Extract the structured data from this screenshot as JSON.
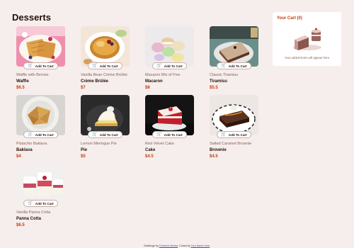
{
  "page": {
    "title": "Desserts"
  },
  "add_to_cart_label": "Add To Cart",
  "products": [
    {
      "category": "Waffle with Berries",
      "name": "Waffle",
      "price": "$6.5",
      "image": "waffle"
    },
    {
      "category": "Vanilla Bean Crème Brûlée",
      "name": "Crème Brûlée",
      "price": "$7",
      "image": "creme-brulee"
    },
    {
      "category": "Macaron Mix of Five",
      "name": "Macaron",
      "price": "$8",
      "image": "macaron"
    },
    {
      "category": "Classic Tiramisu",
      "name": "Tiramisu",
      "price": "$5.5",
      "image": "tiramisu"
    },
    {
      "category": "Pistachio Baklava",
      "name": "Baklava",
      "price": "$4",
      "image": "baklava"
    },
    {
      "category": "Lemon Meringue Pie",
      "name": "Pie",
      "price": "$5",
      "image": "pie"
    },
    {
      "category": "Red Velvet Cake",
      "name": "Cake",
      "price": "$4.5",
      "image": "cake"
    },
    {
      "category": "Salted Caramel Brownie",
      "name": "Brownie",
      "price": "$4.5",
      "image": "brownie"
    },
    {
      "category": "Vanilla Panna Cotta",
      "name": "Panna Cotta",
      "price": "$6.5",
      "image": "panna-cotta"
    }
  ],
  "cart": {
    "title": "Your Cart (0)",
    "empty_message": "Your added items will appear here",
    "illustration": "empty-cake-icon"
  },
  "footer": {
    "prefix": "Challenge by ",
    "link1": "Frontend Mentor",
    "mid": ". Coded by ",
    "link2": "Your Name Here",
    "suffix": "."
  },
  "colors": {
    "background": "#f6eeec",
    "accent": "#c73b0f",
    "text": "#260f08",
    "muted": "#87635a"
  }
}
